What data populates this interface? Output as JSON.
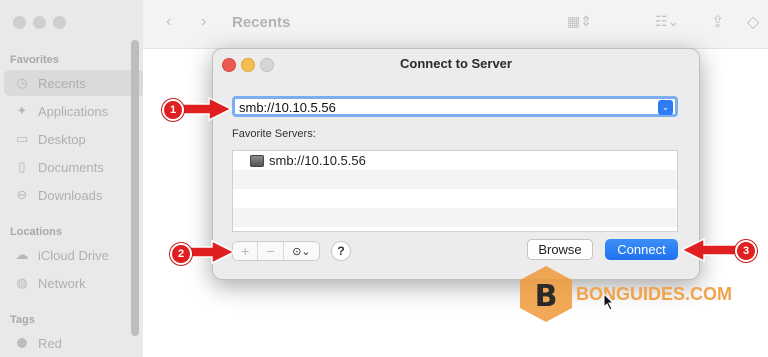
{
  "finder": {
    "title": "Recents",
    "sidebar": {
      "favorites_heading": "Favorites",
      "favorites": [
        {
          "label": "Recents",
          "icon": "clock-icon"
        },
        {
          "label": "Applications",
          "icon": "applications-icon"
        },
        {
          "label": "Desktop",
          "icon": "desktop-icon"
        },
        {
          "label": "Documents",
          "icon": "document-icon"
        },
        {
          "label": "Downloads",
          "icon": "download-icon"
        }
      ],
      "locations_heading": "Locations",
      "locations": [
        {
          "label": "iCloud Drive",
          "icon": "cloud-icon"
        },
        {
          "label": "Network",
          "icon": "globe-icon"
        }
      ],
      "tags_heading": "Tags",
      "tags": [
        {
          "label": "Red",
          "color": "#bdbdbd"
        }
      ]
    }
  },
  "dialog": {
    "title": "Connect to Server",
    "address_value": "smb://10.10.5.56",
    "favorites_label": "Favorite Servers:",
    "favorite_servers": [
      "smb://10.10.5.56"
    ],
    "add_label": "+",
    "remove_label": "−",
    "options_label": "⊙⌄",
    "help_label": "?",
    "browse_label": "Browse",
    "connect_label": "Connect"
  },
  "callouts": [
    "1",
    "2",
    "3"
  ],
  "watermark": {
    "text": "BONGUIDES.COM",
    "letter": "B"
  },
  "colors": {
    "accent": "#1f72ef",
    "callout": "#e02020",
    "watermark": "#f0a34b"
  }
}
